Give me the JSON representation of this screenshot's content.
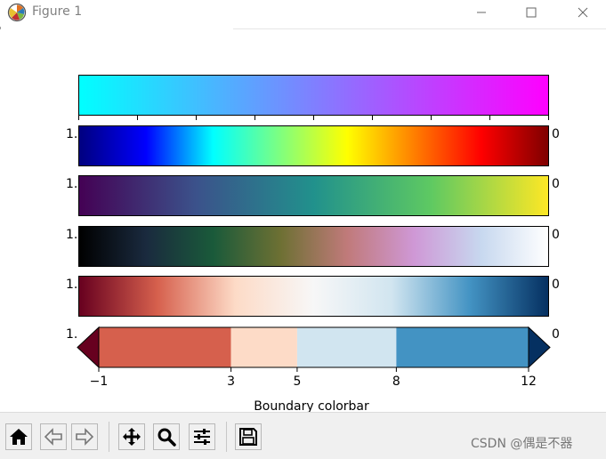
{
  "window": {
    "title": "Figure 1",
    "buttons": {
      "minimize": "—",
      "maximize": "☐",
      "close": "✕"
    }
  },
  "figure": {
    "colorbars": [
      {
        "name": "cool",
        "left_label": "",
        "right_label": "",
        "stops": [
          "#00ffff",
          "#ff00ff"
        ]
      },
      {
        "name": "jet",
        "left_label": "1.",
        "right_label": "0",
        "stops": [
          "#00007f",
          "#0000ff",
          "#00ffff",
          "#7fff7f",
          "#ffff00",
          "#ff7f00",
          "#ff0000",
          "#7f0000"
        ]
      },
      {
        "name": "viridis",
        "left_label": "1.",
        "right_label": "0",
        "stops": [
          "#440154",
          "#3b528b",
          "#21918c",
          "#5ec962",
          "#fde725"
        ]
      },
      {
        "name": "cubehelix",
        "left_label": "1.",
        "right_label": "0",
        "stops": [
          "#000000",
          "#1a2a3e",
          "#1a5a3a",
          "#6d7033",
          "#c07a7a",
          "#cf98d6",
          "#c7d8ef",
          "#ffffff"
        ]
      },
      {
        "name": "RdBu",
        "left_label": "1.",
        "right_label": "0",
        "stops": [
          "#67001f",
          "#d6604d",
          "#fddbc7",
          "#f7f7f7",
          "#d1e5f0",
          "#4393c3",
          "#053061"
        ]
      }
    ],
    "boundary_colorbar": {
      "left_label": "1.",
      "right_label": "0",
      "boundaries": [
        -1,
        3,
        5,
        8,
        12
      ],
      "tick_labels": [
        "−1",
        "3",
        "5",
        "8",
        "12"
      ],
      "colors": [
        "#d6604d",
        "#fddbc7",
        "#d1e5f0",
        "#4393c3"
      ],
      "extend_colors": {
        "min": "#67001f",
        "max": "#053061"
      },
      "label": "Boundary colorbar"
    }
  },
  "toolbar": {
    "buttons": [
      {
        "name": "home",
        "icon": "home-icon"
      },
      {
        "name": "back",
        "icon": "arrow-left-icon"
      },
      {
        "name": "forward",
        "icon": "arrow-right-icon"
      },
      {
        "name": "pan",
        "icon": "move-icon"
      },
      {
        "name": "zoom",
        "icon": "search-icon"
      },
      {
        "name": "configure",
        "icon": "sliders-icon"
      },
      {
        "name": "save",
        "icon": "save-icon"
      }
    ],
    "watermark": "CSDN @偶是不器"
  }
}
